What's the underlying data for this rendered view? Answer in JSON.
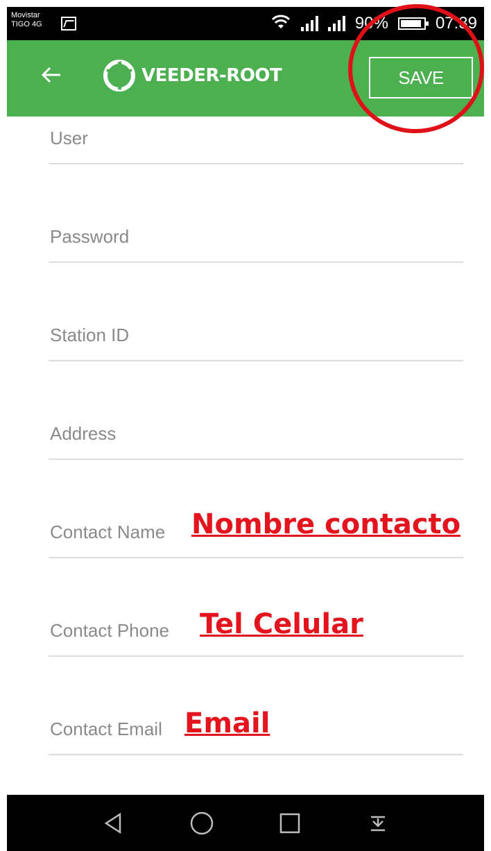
{
  "status_bar": {
    "carrier_line1": "Movistar",
    "carrier_line2": "TIGO 4G",
    "battery": "90%",
    "time": "07:39"
  },
  "toolbar": {
    "back_icon": "arrow-left-icon",
    "logo_text": "VEEDER-ROOT",
    "save_label": "SAVE",
    "background": "#4caf50"
  },
  "form": {
    "fields": [
      {
        "label": "User",
        "value": ""
      },
      {
        "label": "Password",
        "value": ""
      },
      {
        "label": "Station ID",
        "value": ""
      },
      {
        "label": "Address",
        "value": ""
      },
      {
        "label": "Contact Name",
        "value": ""
      },
      {
        "label": "Contact Phone",
        "value": ""
      },
      {
        "label": "Contact Email",
        "value": ""
      }
    ]
  },
  "annotations": {
    "contact_name": "Nombre contacto",
    "contact_phone": "Tel Celular",
    "contact_email": "Email",
    "color": "#e4141e"
  },
  "nav_bar": {
    "back": "triangle-back-icon",
    "home": "circle-home-icon",
    "recents": "square-recents-icon",
    "notifications": "pull-down-icon"
  }
}
